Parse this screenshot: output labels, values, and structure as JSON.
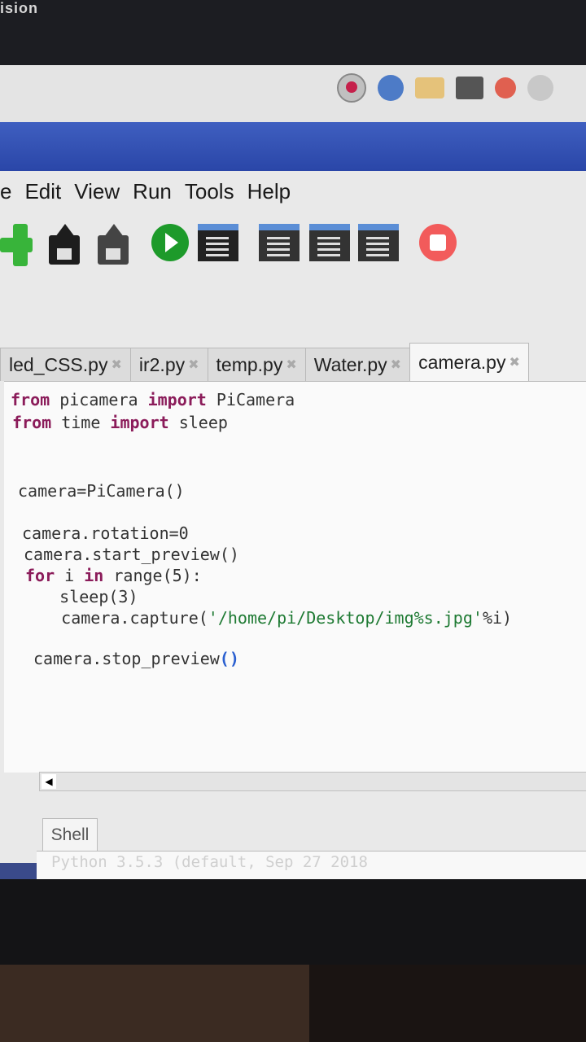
{
  "menubar": {
    "items": [
      "e",
      "Edit",
      "View",
      "Run",
      "Tools",
      "Help"
    ]
  },
  "tabs": [
    {
      "label": "led_CSS.py",
      "close": "✖"
    },
    {
      "label": "ir2.py",
      "close": "✖"
    },
    {
      "label": "temp.py",
      "close": "✖"
    },
    {
      "label": "Water.py",
      "close": "✖"
    },
    {
      "label": "camera.py",
      "close": "✖",
      "active": true
    }
  ],
  "code": {
    "l1": {
      "kw1": "from",
      "t1": " picamera ",
      "kw2": "import",
      "t2": " PiCamera"
    },
    "l2": {
      "kw1": "from",
      "t1": " time ",
      "kw2": "import",
      "t2": " sleep"
    },
    "l3": "camera=PiCamera()",
    "l4": "camera.rotation=0",
    "l5": "camera.start_preview()",
    "l6": {
      "kw1": "for",
      "t1": " i ",
      "kw2": "in",
      "t2": " range(5):"
    },
    "l7": "    sleep(3)",
    "l8": {
      "t1": "    camera.capture(",
      "str": "'/home/pi/Desktop/img%s.jpg'",
      "t2": "%i)"
    },
    "l9": {
      "t1": "camera.stop_preview",
      "paren": "()"
    }
  },
  "shell": {
    "tab_label": "Shell",
    "text": "Python 3.5.3 (default, Sep 27 2018"
  },
  "bezel_label": "ision",
  "colors": {
    "keyword": "#8b1c5a",
    "run_green": "#1d9a2a",
    "stop_red": "#f25b5b",
    "titlebar_blue": "#2a46a8"
  }
}
